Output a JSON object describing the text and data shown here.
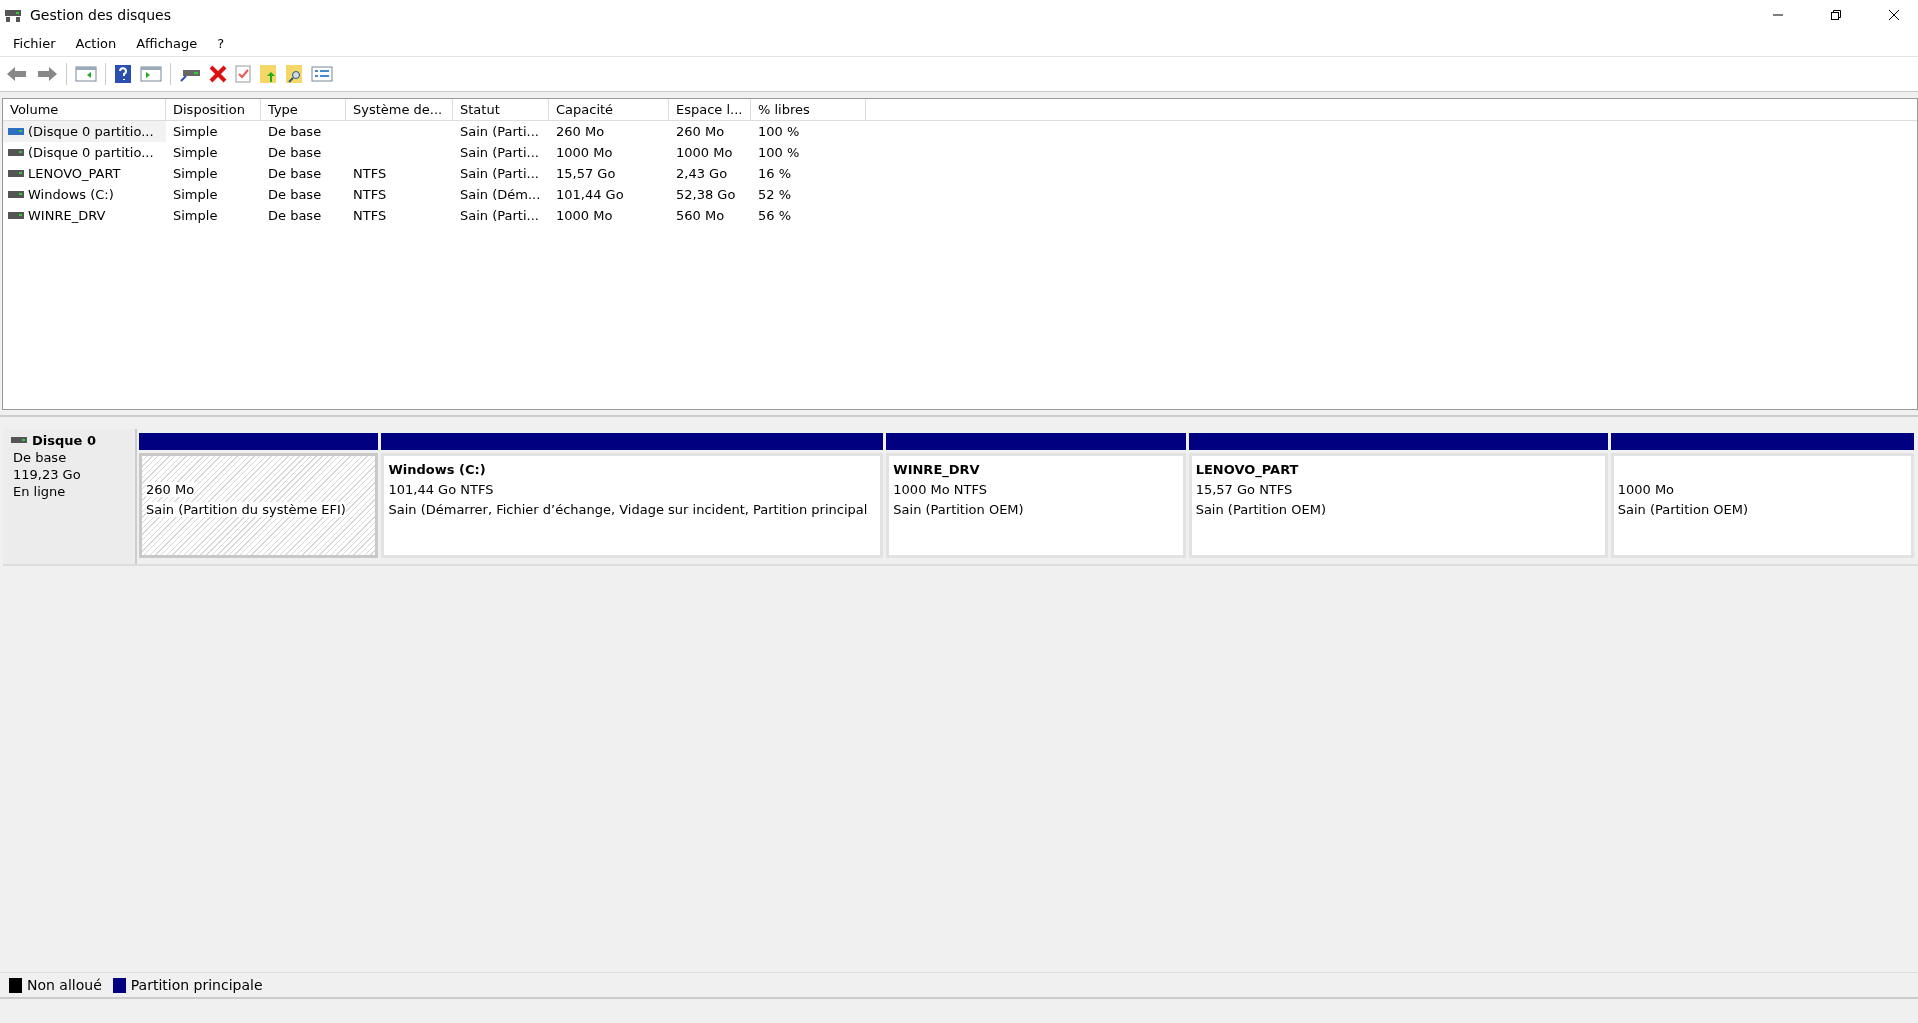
{
  "window": {
    "title": "Gestion des disques"
  },
  "menu": [
    "Fichier",
    "Action",
    "Affichage",
    "?"
  ],
  "table": {
    "columns": [
      "Volume",
      "Disposition",
      "Type",
      "Système de...",
      "Statut",
      "Capacité",
      "Espace l...",
      "% libres"
    ],
    "rows": [
      {
        "selected": true,
        "cells": [
          "(Disque 0 partitio...",
          "Simple",
          "De base",
          "",
          "Sain (Parti...",
          "260 Mo",
          "260 Mo",
          "100 %"
        ]
      },
      {
        "selected": false,
        "cells": [
          "(Disque 0 partitio...",
          "Simple",
          "De base",
          "",
          "Sain (Parti...",
          "1000 Mo",
          "1000 Mo",
          "100 %"
        ]
      },
      {
        "selected": false,
        "cells": [
          "LENOVO_PART",
          "Simple",
          "De base",
          "NTFS",
          "Sain (Parti...",
          "15,57 Go",
          "2,43 Go",
          "16 %"
        ]
      },
      {
        "selected": false,
        "cells": [
          "Windows (C:)",
          "Simple",
          "De base",
          "NTFS",
          "Sain (Dém...",
          "101,44 Go",
          "52,38 Go",
          "52 %"
        ]
      },
      {
        "selected": false,
        "cells": [
          "WINRE_DRV",
          "Simple",
          "De base",
          "NTFS",
          "Sain (Parti...",
          "1000 Mo",
          "560 Mo",
          "56 %"
        ]
      }
    ]
  },
  "disk": {
    "name": "Disque 0",
    "type": "De base",
    "size": "119,23 Go",
    "status": "En ligne",
    "partitions": [
      {
        "selected": true,
        "color": "#000080",
        "size": "260 Mo",
        "status": "Sain (Partition du système EFI)"
      },
      {
        "selected": false,
        "color": "#000080",
        "name": "Windows  (C:)",
        "size": "101,44 Go NTFS",
        "status": "Sain (Démarrer, Fichier d’échange, Vidage sur incident, Partition principal"
      },
      {
        "selected": false,
        "color": "#000080",
        "name": "WINRE_DRV",
        "size": "1000 Mo NTFS",
        "status": "Sain (Partition OEM)"
      },
      {
        "selected": false,
        "color": "#000080",
        "name": "LENOVO_PART",
        "size": "15,57 Go NTFS",
        "status": "Sain (Partition OEM)"
      },
      {
        "selected": false,
        "color": "#000080",
        "size": "1000 Mo",
        "status": "Sain (Partition OEM)"
      }
    ]
  },
  "legend": [
    {
      "label": "Non alloué",
      "color": "#000000"
    },
    {
      "label": "Partition principale",
      "color": "#000080"
    }
  ]
}
